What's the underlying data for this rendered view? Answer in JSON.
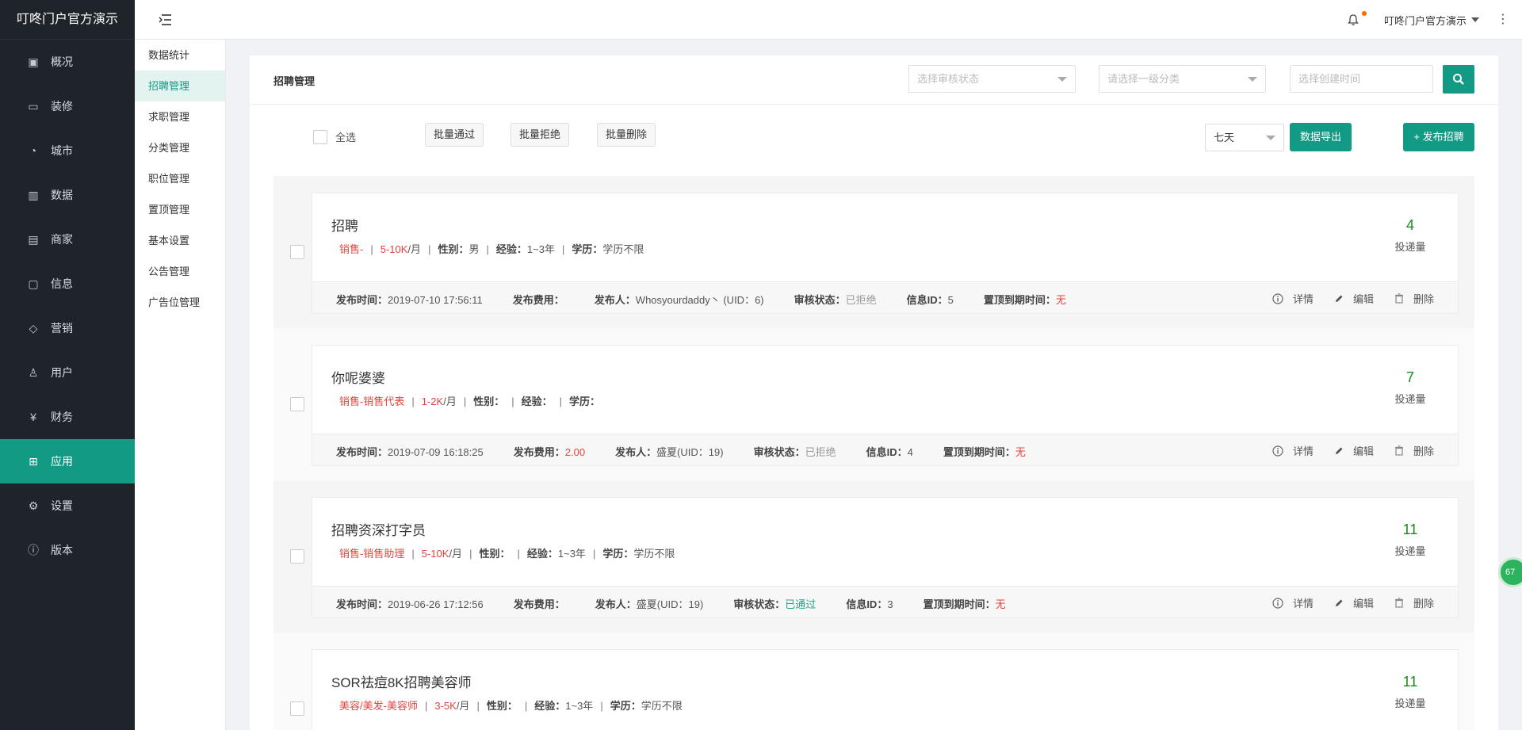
{
  "brand": "叮咚门户官方演示",
  "nav": [
    {
      "label": "概况",
      "icon": "overview-icon"
    },
    {
      "label": "装修",
      "icon": "decor-icon"
    },
    {
      "label": "城市",
      "icon": "city-icon"
    },
    {
      "label": "数据",
      "icon": "chart-icon"
    },
    {
      "label": "商家",
      "icon": "shop-icon"
    },
    {
      "label": "信息",
      "icon": "message-icon"
    },
    {
      "label": "营销",
      "icon": "tag-icon"
    },
    {
      "label": "用户",
      "icon": "user-icon"
    },
    {
      "label": "财务",
      "icon": "yuan-icon"
    },
    {
      "label": "应用",
      "icon": "apps-icon"
    },
    {
      "label": "设置",
      "icon": "settings-icon"
    },
    {
      "label": "版本",
      "icon": "info-icon"
    }
  ],
  "submenu": [
    "数据统计",
    "招聘管理",
    "求职管理",
    "分类管理",
    "职位管理",
    "置顶管理",
    "基本设置",
    "公告管理",
    "广告位管理"
  ],
  "header": {
    "user": "叮咚门户官方演示"
  },
  "card": {
    "title": "招聘管理",
    "filter_status_placeholder": "选择审核状态",
    "filter_category_placeholder": "请选择一级分类",
    "filter_time_placeholder": "选择创建时间"
  },
  "toolbar": {
    "select_all": "全选",
    "batch_pass": "批量通过",
    "batch_reject": "批量拒绝",
    "batch_delete": "批量删除",
    "range": "七天",
    "export": "数据导出",
    "publish": "+ 发布招聘"
  },
  "labels": {
    "count": "投递量",
    "gender": "性别：",
    "experience": "经验：",
    "education": "学历：",
    "publish_time": "发布时间：",
    "publish_fee": "发布费用：",
    "publisher": "发布人：",
    "audit_status": "审核状态：",
    "info_id": "信息ID：",
    "top_expire": "置顶到期时间：",
    "detail": "详情",
    "edit": "编辑",
    "delete": "删除"
  },
  "jobs": [
    {
      "title": "招聘",
      "category": "销售-",
      "salary": "5-10K",
      "salary_unit": "/月",
      "gender": "男",
      "experience": "1~3年",
      "education": "学历不限",
      "count": "4",
      "publish_time": "2019-07-10 17:56:11",
      "fee": "",
      "publisher": "Whosyourdaddy丶 (UID：6)",
      "status": "已拒绝",
      "status_type": "grey",
      "info_id": "5",
      "top_expire": "无"
    },
    {
      "title": "你呢婆婆",
      "category": "销售-销售代表",
      "salary": "1-2K",
      "salary_unit": "/月",
      "gender": "",
      "experience": "",
      "education": "",
      "count": "7",
      "publish_time": "2019-07-09 16:18:25",
      "fee": "2.00",
      "publisher": "盛夏(UID：19)",
      "status": "已拒绝",
      "status_type": "grey",
      "info_id": "4",
      "top_expire": "无"
    },
    {
      "title": "招聘资深打字员",
      "category": "销售-销售助理",
      "salary": "5-10K",
      "salary_unit": "/月",
      "gender": "",
      "experience": "1~3年",
      "education": "学历不限",
      "count": "11",
      "publish_time": "2019-06-26 17:12:56",
      "fee": "",
      "publisher": "盛夏(UID：19)",
      "status": "已通过",
      "status_type": "teal",
      "info_id": "3",
      "top_expire": "无"
    },
    {
      "title": "SOR祛痘8K招聘美容师",
      "category": "美容/美发-美容师",
      "salary": "3-5K",
      "salary_unit": "/月",
      "gender": "",
      "experience": "1~3年",
      "education": "学历不限",
      "count": "11",
      "publish_time": "",
      "fee": "",
      "publisher": "",
      "status": "",
      "status_type": "grey",
      "info_id": "",
      "top_expire": ""
    }
  ],
  "float_badge": "67"
}
